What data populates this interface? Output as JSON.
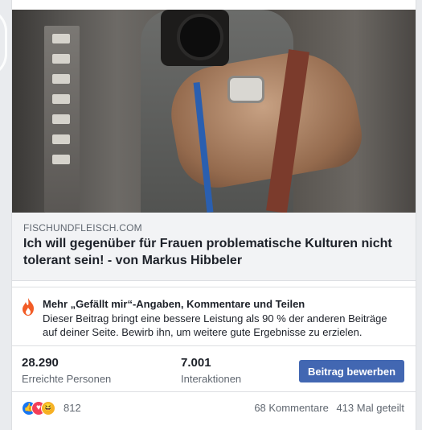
{
  "link": {
    "source": "FISCHUNDFLEISCH.COM",
    "title": "Ich will gegenüber für Frauen problematische Kulturen nicht tolerant sein! - von Markus Hibbeler"
  },
  "promo": {
    "heading": "Mehr „Gefällt mir“-Angaben, Kommentare und Teilen",
    "body": "Dieser Beitrag bringt eine bessere Leistung als 90 % der anderen Beiträge auf deiner Seite. Bewirb ihn, um weitere gute Ergebnisse zu erzielen.",
    "icon": "fire-icon"
  },
  "stats": {
    "reach_value": "28.290",
    "reach_label": "Erreichte Personen",
    "interactions_value": "7.001",
    "interactions_label": "Interaktionen",
    "boost_label": "Beitrag bewerben"
  },
  "reactions": {
    "count": "812",
    "comments": "68 Kommentare",
    "shares": "413 Mal geteilt",
    "icons": [
      "like-icon",
      "love-icon",
      "haha-icon"
    ]
  },
  "colors": {
    "accent": "#4267b2",
    "fire": "#f25c26"
  }
}
